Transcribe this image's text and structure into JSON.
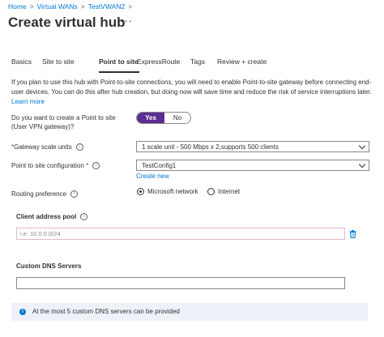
{
  "breadcrumb": {
    "home": "Home",
    "virtual_wans": "Virtual WANs",
    "wan": "TestVWAN2",
    "separator": ">"
  },
  "page": {
    "title": "Create virtual hub",
    "more": "···"
  },
  "tabs": [
    "Basics",
    "Site to site",
    "Point to site",
    "ExpressRoute",
    "Tags",
    "Review + create"
  ],
  "active_tab": "Point to site",
  "info": {
    "text": "If you plan to use this hub with Point-to-site connections, you will need to enable Point-to-site gateway before connecting end-user devices. You can do this after hub creation, but doing now will save time and reduce the risk of service interruptions later.",
    "learn_more": "Learn more"
  },
  "form": {
    "p2s_question": "Do you want to create a Point to site (User VPN gateway)?",
    "toggle_yes": "Yes",
    "toggle_no": "No",
    "toggle_selected": "Yes",
    "gateway_label": "Gateway scale units",
    "required_mark": "*",
    "gateway_value": "1 scale unit - 500 Mbps x 2,supports 500 clients",
    "p2s_config_label": "Point to site configuration",
    "p2s_config_value": "TestConfig1",
    "create_new": "Create new",
    "routing_label": "Routing preference",
    "routing_microsoft": "Microsoft network",
    "routing_internet": "Internet",
    "routing_selected": "Microsoft network"
  },
  "client_pool": {
    "title": "Client address pool",
    "placeholder": "i.e. 10.0.0.0/24",
    "value": ""
  },
  "dns": {
    "title": "Custom DNS Servers",
    "value": ""
  },
  "banner": {
    "text": "At the most 5 custom DNS servers can be provided"
  },
  "icons": {
    "info": "info-icon",
    "chevron": "chevron-down-icon",
    "delete": "trash-icon",
    "banner": "info-filled-icon"
  },
  "colors": {
    "accent": "#5c2d91",
    "link": "#0078d4",
    "required": "#a4262c",
    "banner_bg": "#eef2f8"
  }
}
